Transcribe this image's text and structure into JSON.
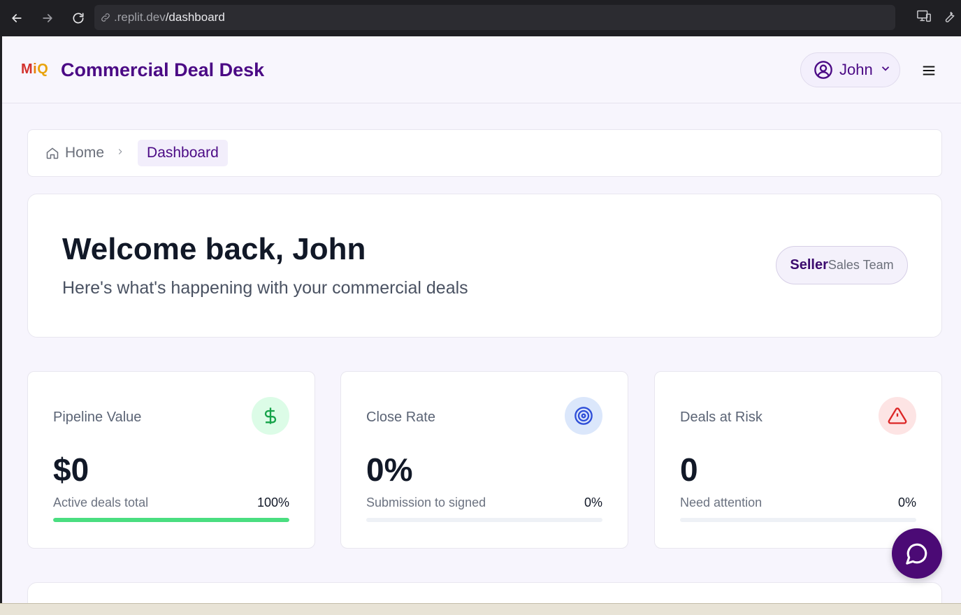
{
  "browser": {
    "url_host": ".replit.dev",
    "url_path": "/dashboard"
  },
  "header": {
    "logo_m": "M",
    "logo_i": "i",
    "logo_q": "Q",
    "title": "Commercial Deal Desk",
    "user_name": "John"
  },
  "breadcrumb": {
    "home": "Home",
    "current": "Dashboard"
  },
  "welcome": {
    "heading": "Welcome back, John",
    "subheading": "Here's what's happening with your commercial deals",
    "role": "Seller",
    "team": "Sales Team"
  },
  "stats": [
    {
      "label": "Pipeline Value",
      "value": "$0",
      "sub": "Active deals total",
      "pct": "100%",
      "progress": 1.0,
      "icon": "dollar-icon",
      "color": "#4ade80",
      "icon_bg": "#dcfce7",
      "icon_color": "#16a34a"
    },
    {
      "label": "Close Rate",
      "value": "0%",
      "sub": "Submission to signed",
      "pct": "0%",
      "progress": 0,
      "icon": "target-icon",
      "color": "#3b5bdb",
      "icon_bg": "#dbe7fb",
      "icon_color": "#2f4fd8"
    },
    {
      "label": "Deals at Risk",
      "value": "0",
      "sub": "Need attention",
      "pct": "0%",
      "progress": 0,
      "icon": "alert-triangle-icon",
      "color": "#dc2626",
      "icon_bg": "#fde4e4",
      "icon_color": "#dc2626"
    }
  ],
  "colors": {
    "brand": "#4b0a85",
    "page_bg": "#f7f5fd",
    "chat_fab": "#4b0a75"
  }
}
